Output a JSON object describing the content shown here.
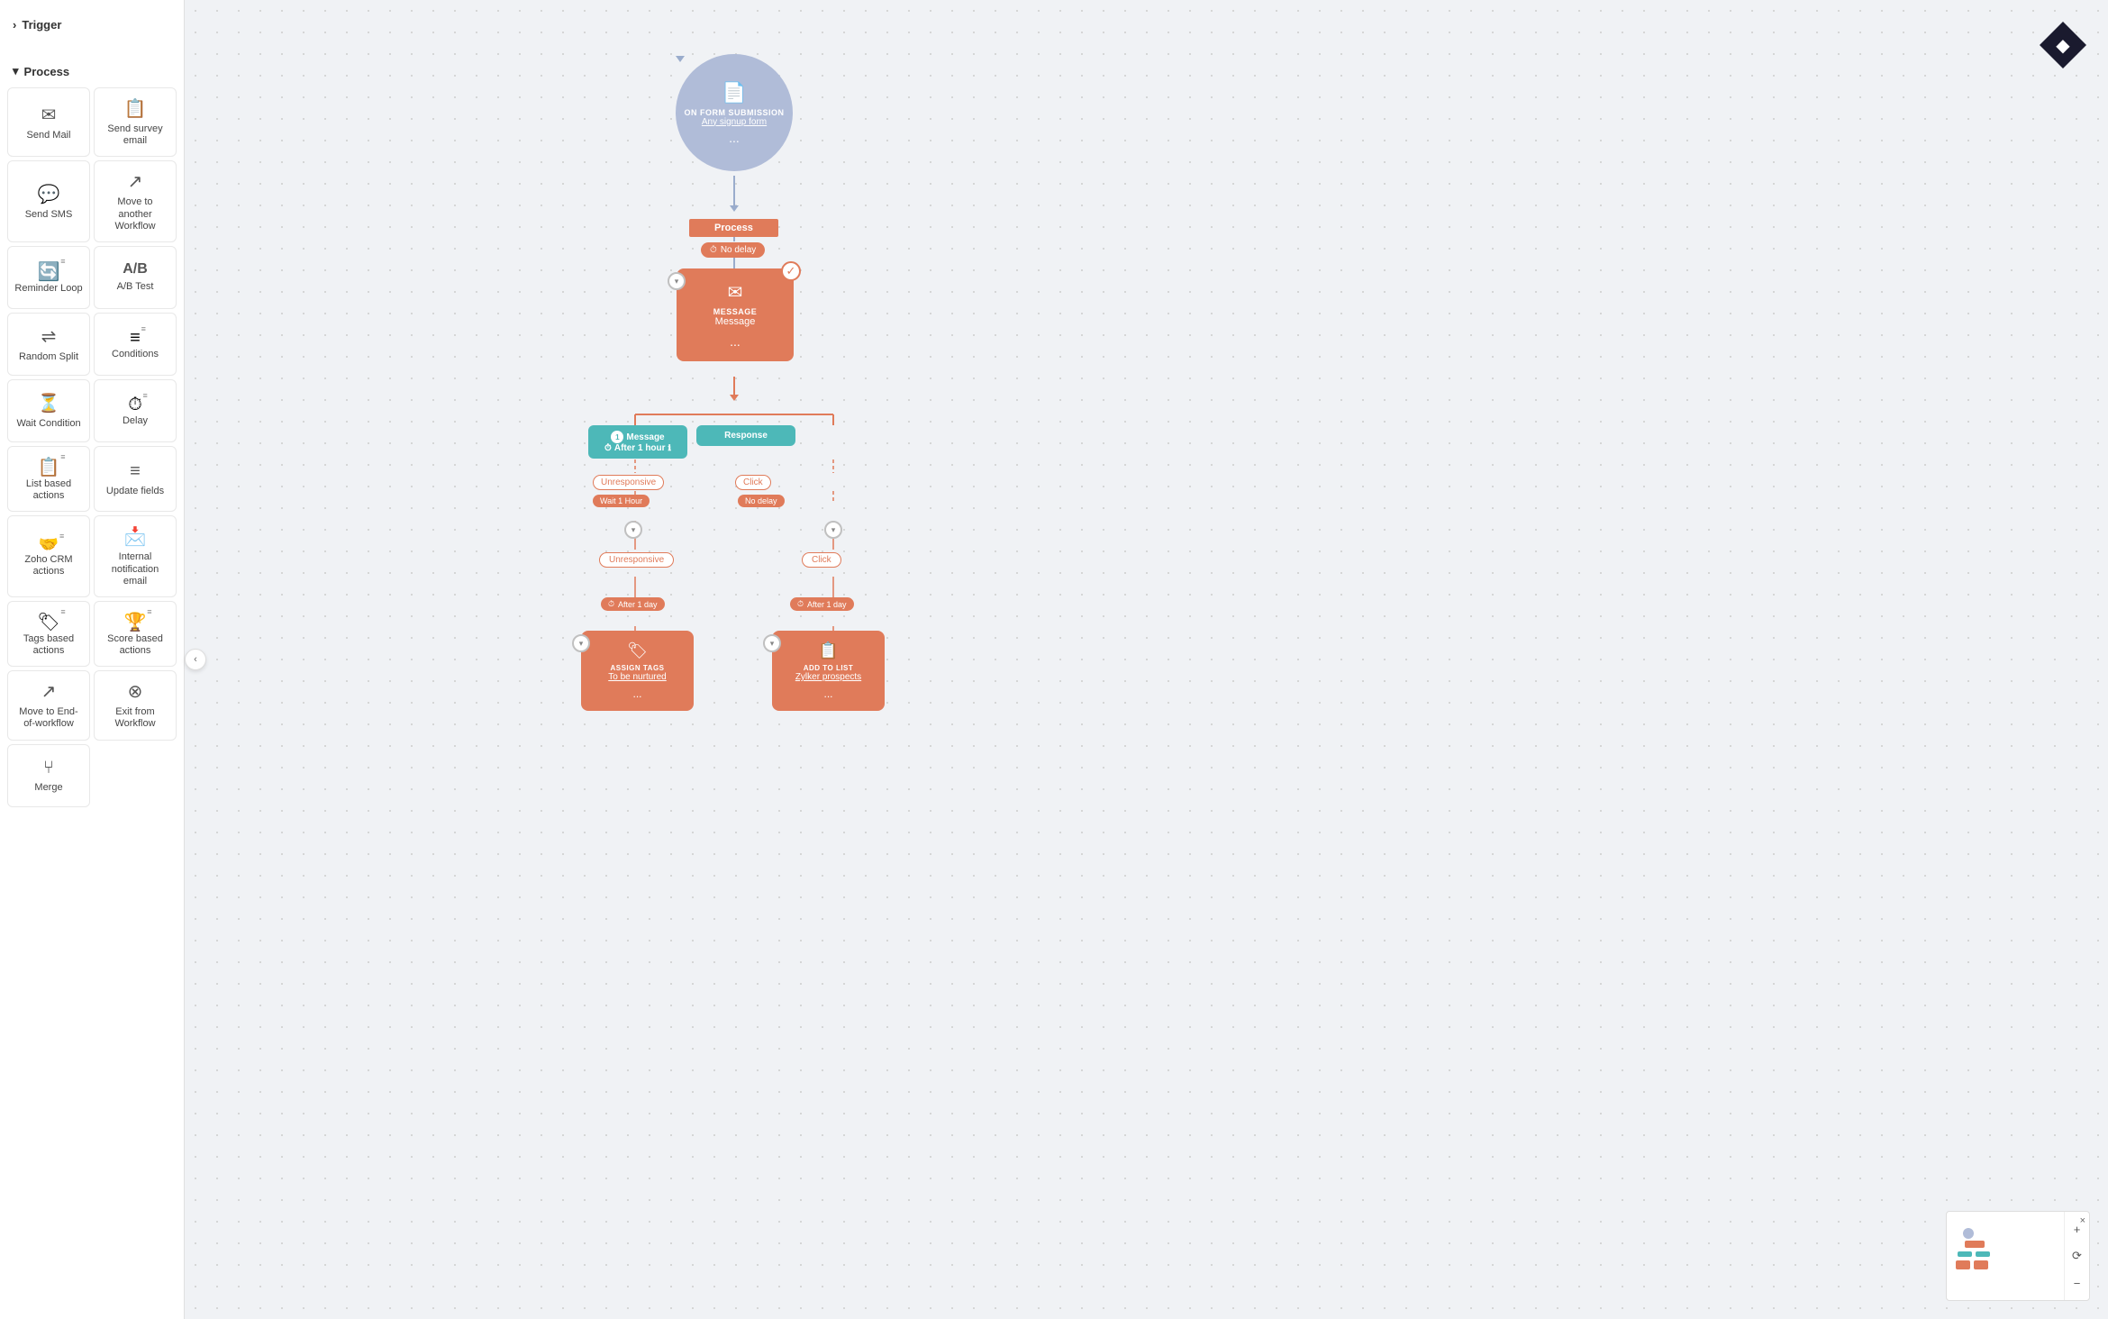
{
  "sidebar": {
    "trigger_label": "Trigger",
    "process_label": "Process",
    "items": [
      {
        "id": "send-mail",
        "label": "Send Mail",
        "icon": "✉"
      },
      {
        "id": "send-survey",
        "label": "Send survey email",
        "icon": "📋"
      },
      {
        "id": "send-sms",
        "label": "Send SMS",
        "icon": "💬"
      },
      {
        "id": "move-workflow",
        "label": "Move to another Workflow",
        "icon": "↗"
      },
      {
        "id": "reminder-loop",
        "label": "Reminder Loop",
        "icon": "🔄",
        "stack": true
      },
      {
        "id": "ab-test",
        "label": "A/B Test",
        "icon": "A/B"
      },
      {
        "id": "random-split",
        "label": "Random Split",
        "icon": "⇌"
      },
      {
        "id": "conditions",
        "label": "Conditions",
        "icon": "≡",
        "stack": true
      },
      {
        "id": "wait-condition",
        "label": "Wait Condition",
        "icon": "⏳"
      },
      {
        "id": "delay",
        "label": "Delay",
        "icon": "⏱",
        "stack": true
      },
      {
        "id": "list-based",
        "label": "List based actions",
        "icon": "📋",
        "stack": true
      },
      {
        "id": "update-fields",
        "label": "Update fields",
        "icon": "≡"
      },
      {
        "id": "zoho-crm",
        "label": "Zoho CRM actions",
        "icon": "🤝",
        "stack": true
      },
      {
        "id": "internal-notif",
        "label": "Internal notification email",
        "icon": "📩"
      },
      {
        "id": "tags-based",
        "label": "Tags based actions",
        "icon": "🏷",
        "stack": true
      },
      {
        "id": "score-based",
        "label": "Score based actions",
        "icon": "🏆",
        "stack": true
      },
      {
        "id": "move-end",
        "label": "Move to End-of-workflow",
        "icon": "↗"
      },
      {
        "id": "exit-workflow",
        "label": "Exit from Workflow",
        "icon": "⊗"
      },
      {
        "id": "merge",
        "label": "Merge",
        "icon": "⑂"
      }
    ]
  },
  "workflow": {
    "trigger_node": {
      "title": "ON FORM SUBMISSION",
      "subtitle": "Any signup form",
      "dots": "..."
    },
    "process_label": "Process",
    "delay_no_delay": "No delay",
    "message_node": {
      "type": "MESSAGE",
      "name": "Message",
      "dots": "..."
    },
    "branch_message": {
      "number": "1",
      "label": "Message",
      "value": "After 1 hour"
    },
    "branch_response": {
      "label": "Response"
    },
    "cond_unresponsive": "Unresponsive",
    "cond_click": "Click",
    "wait_1hour": "Wait 1 Hour",
    "no_delay": "No delay",
    "left_branch_label": "Unresponsive",
    "right_branch_label": "Click",
    "after_1day_left": "After 1 day",
    "after_1day_right": "After 1 day",
    "assign_tags_node": {
      "type": "ASSIGN TAGS",
      "name": "To be nurtured",
      "dots": "..."
    },
    "add_to_list_node": {
      "type": "ADD TO LIST",
      "name": "Zylker prospects",
      "dots": "..."
    }
  },
  "colors": {
    "salmon": "#e07b5a",
    "teal": "#4db8b8",
    "blue_gray": "#b0bcd8",
    "dark": "#1a1a2e"
  },
  "toolbar": {
    "close_label": "×",
    "zoom_in_label": "+",
    "zoom_reset_label": "⟳",
    "zoom_out_label": "−",
    "collapse_label": "‹"
  }
}
